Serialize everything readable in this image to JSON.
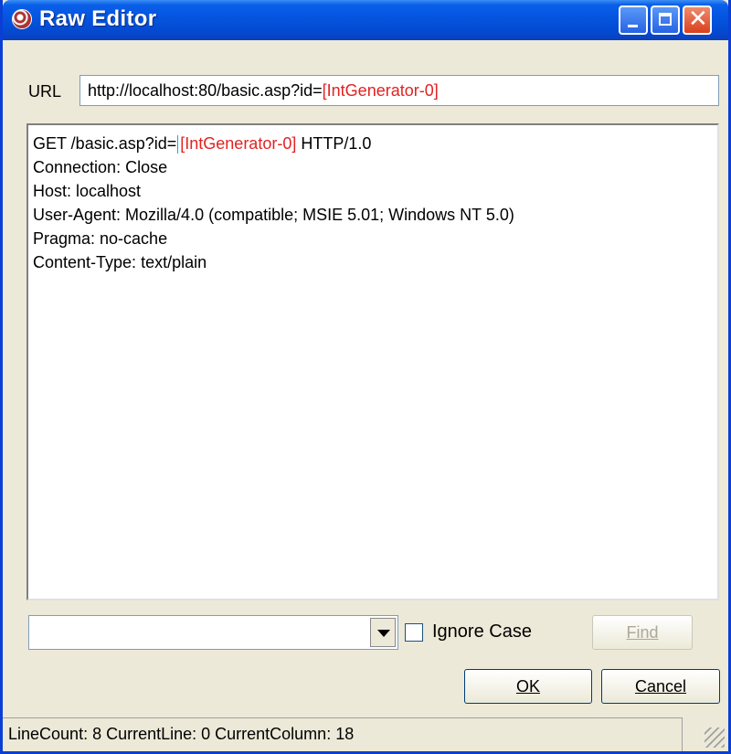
{
  "window": {
    "title": "Raw Editor"
  },
  "url": {
    "label": "URL",
    "value_prefix": "http://localhost:80/basic.asp?id=",
    "value_token": "[IntGenerator-0]"
  },
  "editor": {
    "line1_prefix": "GET /basic.asp?id=",
    "line1_token": "[IntGenerator-0]",
    "line1_suffix": " HTTP/1.0",
    "lines": [
      "Connection: Close",
      "Host: localhost",
      "User-Agent: Mozilla/4.0 (compatible; MSIE 5.01; Windows NT 5.0)",
      "Pragma: no-cache",
      "Content-Type: text/plain"
    ]
  },
  "search": {
    "combo_value": "",
    "ignore_case_label": "Ignore Case",
    "ignore_case_checked": false,
    "find_label": "Find"
  },
  "buttons": {
    "ok": "OK",
    "cancel": "Cancel"
  },
  "status": {
    "text": "LineCount: 8 CurrentLine: 0 CurrentColumn: 18"
  },
  "colors": {
    "titlebar": "#0556e0",
    "token": "#e32222",
    "face": "#ece9d8"
  },
  "icons": {
    "app": "raw-editor-app-icon",
    "minimize": "minimize-icon",
    "maximize": "maximize-icon",
    "close": "close-icon",
    "dropdown": "dropdown-arrow-icon",
    "grip": "resize-grip-icon"
  }
}
